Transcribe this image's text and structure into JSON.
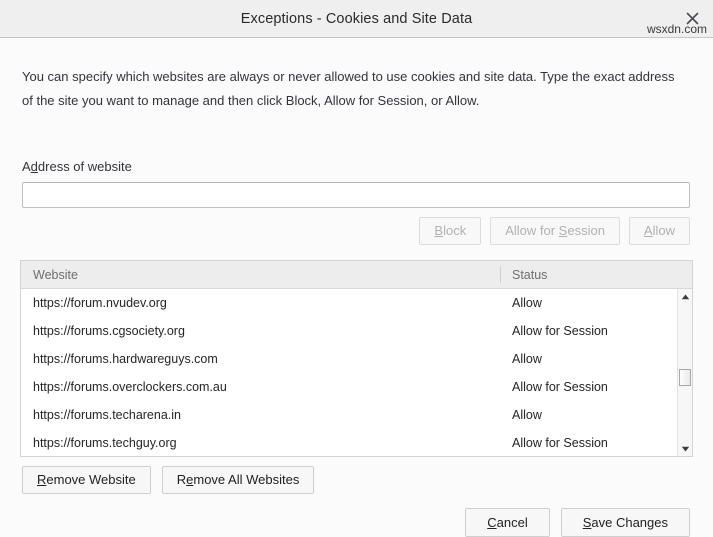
{
  "window": {
    "title": "Exceptions - Cookies and Site Data",
    "close_icon": "close-icon"
  },
  "body": {
    "description": "You can specify which websites are always or never allowed to use cookies and site data. Type the exact address of the site you want to manage and then click Block, Allow for Session, or Allow.",
    "address_label_pre": "A",
    "address_label_key": "d",
    "address_label_post": "dress of website",
    "address_input_value": "",
    "address_input_placeholder": ""
  },
  "actions": {
    "block": {
      "pre": "",
      "key": "B",
      "post": "lock",
      "disabled": true
    },
    "allow_session": {
      "pre": "Allow for ",
      "key": "S",
      "post": "ession",
      "disabled": true
    },
    "allow": {
      "pre": "",
      "key": "A",
      "post": "llow",
      "disabled": true
    }
  },
  "table": {
    "headers": {
      "website": "Website",
      "status": "Status"
    },
    "rows": [
      {
        "website": "https://forum.nvudev.org",
        "status": "Allow"
      },
      {
        "website": "https://forums.cgsociety.org",
        "status": "Allow for Session"
      },
      {
        "website": "https://forums.hardwareguys.com",
        "status": "Allow"
      },
      {
        "website": "https://forums.overclockers.com.au",
        "status": "Allow for Session"
      },
      {
        "website": "https://forums.techarena.in",
        "status": "Allow"
      },
      {
        "website": "https://forums.techguy.org",
        "status": "Allow for Session"
      }
    ],
    "scrollbar": {
      "up_icon": "scroll-up-arrow-icon",
      "down_icon": "scroll-down-arrow-icon"
    }
  },
  "remove_actions": {
    "remove_website": {
      "pre": "",
      "key": "R",
      "post": "emove Website"
    },
    "remove_all": {
      "pre": "R",
      "key": "e",
      "post": "move All Websites"
    }
  },
  "footer": {
    "cancel": {
      "pre": "",
      "key": "C",
      "post": "ancel"
    },
    "save": {
      "pre": "",
      "key": "S",
      "post": "ave Changes"
    }
  },
  "watermark": "wsxdn.com"
}
